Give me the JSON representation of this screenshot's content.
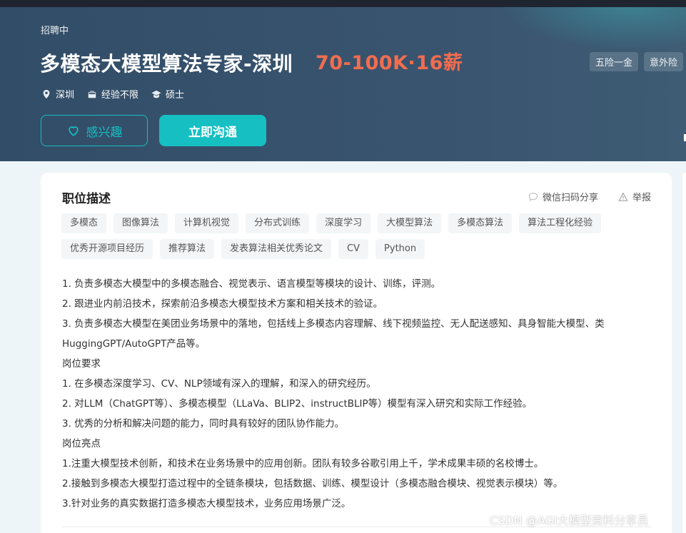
{
  "header": {
    "status": "招聘中",
    "title": "多模态大模型算法专家-深圳",
    "salary": "70-100K·16薪",
    "benefits": [
      "五险一金",
      "意外险"
    ],
    "meta": {
      "location": "深圳",
      "experience": "经验不限",
      "education": "硕士"
    },
    "interest_label": "感兴趣",
    "chat_label": "立即沟通"
  },
  "card": {
    "section_title": "职位描述",
    "share_label": "微信扫码分享",
    "report_label": "举报",
    "tags": [
      "多模态",
      "图像算法",
      "计算机视觉",
      "分布式训练",
      "深度学习",
      "大模型算法",
      "多模态算法",
      "算法工程化经验",
      "优秀开源项目经历",
      "推荐算法",
      "发表算法相关优秀论文",
      "CV",
      "Python"
    ],
    "description": [
      "1. 负责多模态大模型中的多模态融合、视觉表示、语言模型等模块的设计、训练，评测。",
      "2. 跟进业内前沿技术，探索前沿多模态大模型技术方案和相关技术的验证。",
      "3. 负责多模态大模型在美团业务场景中的落地，包括线上多模态内容理解、线下视频监控、无人配送感知、具身智能大模型、类HuggingGPT/AutoGPT产品等。",
      "岗位要求",
      "1. 在多模态深度学习、CV、NLP领域有深入的理解，和深入的研究经历。",
      "2. 对LLM（ChatGPT等）、多模态模型（LLaVa、BLIP2、instructBLIP等）模型有深入研究和实际工作经验。",
      "3. 优秀的分析和解决问题的能力，同时具有较好的团队协作能力。",
      "岗位亮点",
      "1.注重大模型技术创新，和技术在业务场景中的应用创新。团队有较多谷歌引用上千，学术成果丰硕的名校博士。",
      "2.接触到多模态大模型打造过程中的全链条模块，包括数据、训练、模型设计（多模态融合模块、视觉表示模块）等。",
      "3.针对业务的真实数据打造多模态大模型技术，业务应用场景广泛。"
    ]
  },
  "watermark": "CSDN @AGI大模型资料分享员",
  "colors": {
    "accent": "#15bfc2",
    "salary": "#f26d4f",
    "header_bg": "#324d67"
  }
}
